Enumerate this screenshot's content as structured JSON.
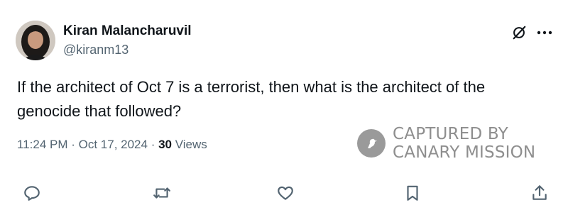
{
  "post": {
    "display_name": "Kiran Malancharuvil",
    "handle": "@kiranm13",
    "text": "If the architect of Oct 7 is a terrorist, then what is the architect of the genocide that followed?",
    "time": "11:24 PM",
    "date": "Oct 17, 2024",
    "separator": " · ",
    "view_count": "30",
    "view_label": " Views"
  },
  "watermark": {
    "line1": "CAPTURED BY",
    "line2": "CANARY MISSION"
  },
  "icons": {
    "grok": "grok-icon",
    "more": "more-icon",
    "reply": "reply-icon",
    "repost": "repost-icon",
    "like": "like-icon",
    "bookmark": "bookmark-icon",
    "share": "share-icon"
  },
  "colors": {
    "text_primary": "#0f1419",
    "text_secondary": "#536471",
    "watermark": "#8e8e8e"
  }
}
